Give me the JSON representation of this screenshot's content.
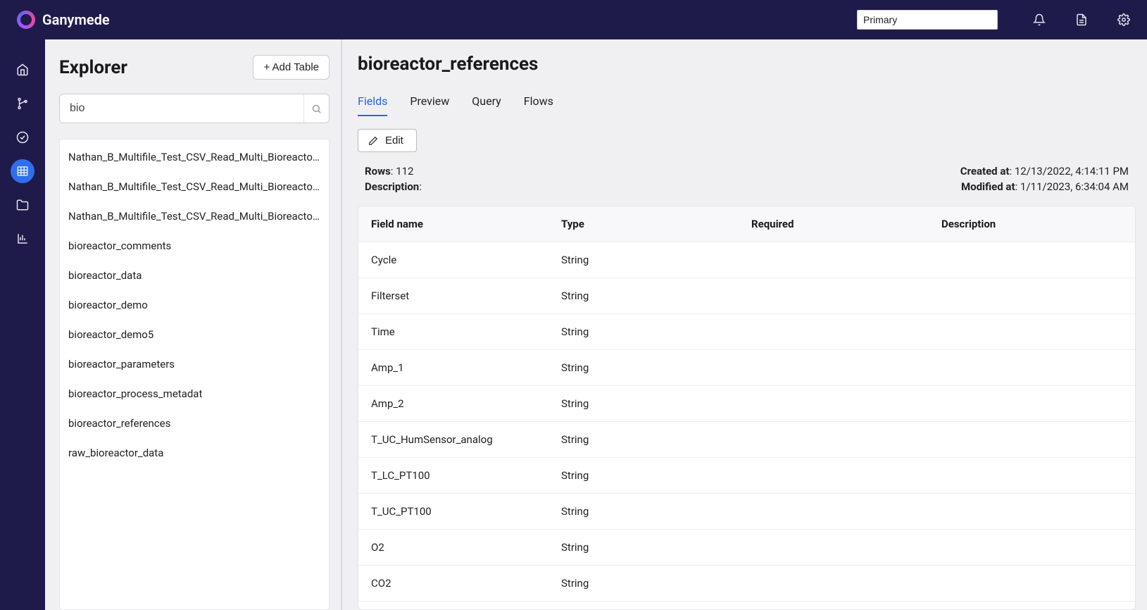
{
  "topbar": {
    "brand": "Ganymede",
    "env_value": "Primary"
  },
  "explorer": {
    "title": "Explorer",
    "add_table_label": "+ Add Table",
    "search_value": "bio",
    "tables": [
      "Nathan_B_Multifile_Test_CSV_Read_Multi_Bioreactor_R...",
      "Nathan_B_Multifile_Test_CSV_Read_Multi_Bioreactor_R...",
      "Nathan_B_Multifile_Test_CSV_Read_Multi_Bioreactor_R...",
      "bioreactor_comments",
      "bioreactor_data",
      "bioreactor_demo",
      "bioreactor_demo5",
      "bioreactor_parameters",
      "bioreactor_process_metadat",
      "bioreactor_references",
      "raw_bioreactor_data"
    ]
  },
  "detail": {
    "title": "bioreactor_references",
    "tabs": {
      "fields": "Fields",
      "preview": "Preview",
      "query": "Query",
      "flows": "Flows"
    },
    "edit_label": "Edit",
    "meta": {
      "rows_label": "Rows",
      "rows_value": "112",
      "description_label": "Description",
      "description_value": "",
      "created_label": "Created at",
      "created_value": "12/13/2022, 4:14:11 PM",
      "modified_label": "Modified at",
      "modified_value": "1/11/2023, 6:34:04 AM"
    },
    "columns": {
      "field_name": "Field name",
      "type": "Type",
      "required": "Required",
      "description": "Description"
    },
    "fields": [
      {
        "name": "Cycle",
        "type": "String",
        "required": "",
        "description": ""
      },
      {
        "name": "Filterset",
        "type": "String",
        "required": "",
        "description": ""
      },
      {
        "name": "Time",
        "type": "String",
        "required": "",
        "description": ""
      },
      {
        "name": "Amp_1",
        "type": "String",
        "required": "",
        "description": ""
      },
      {
        "name": "Amp_2",
        "type": "String",
        "required": "",
        "description": ""
      },
      {
        "name": "T_UC_HumSensor_analog",
        "type": "String",
        "required": "",
        "description": ""
      },
      {
        "name": "T_LC_PT100",
        "type": "String",
        "required": "",
        "description": ""
      },
      {
        "name": "T_UC_PT100",
        "type": "String",
        "required": "",
        "description": ""
      },
      {
        "name": "O2",
        "type": "String",
        "required": "",
        "description": ""
      },
      {
        "name": "CO2",
        "type": "String",
        "required": "",
        "description": ""
      }
    ]
  }
}
